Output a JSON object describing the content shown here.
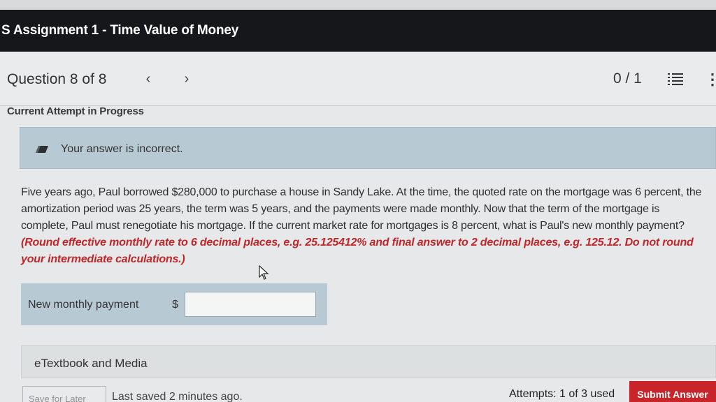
{
  "header": {
    "title": "S Assignment 1 - Time Value of Money"
  },
  "question_nav": {
    "label": "Question 8 of 8",
    "prev_icon": "chevron-left-icon",
    "next_icon": "chevron-right-icon",
    "score": "0 / 1",
    "list_icon": "list-icon",
    "more_icon": "more-vertical-icon"
  },
  "attempt": {
    "header": "Current Attempt in Progress"
  },
  "feedback": {
    "icon": "pencil-icon",
    "message": "Your answer is incorrect."
  },
  "question": {
    "text": "Five years ago, Paul borrowed $280,000 to purchase a house in Sandy Lake. At the time, the quoted rate on the mortgage was 6 percent, the amortization period was 25 years, the term was 5 years, and the payments were made monthly. Now that the term of the mortgage is complete, Paul must renegotiate his mortgage. If the current market rate for mortgages is 8 percent, what is Paul's new monthly payment? ",
    "hint": "(Round effective monthly rate to 6 decimal places, e.g. 25.125412% and final answer to 2 decimal places, e.g. 125.12. Do not round your intermediate calculations.)"
  },
  "answer": {
    "label": "New monthly payment",
    "currency": "$",
    "value": ""
  },
  "etextbook": {
    "label": "eTextbook and Media"
  },
  "footer": {
    "save_label": "Save for Later",
    "last_saved": "Last saved 2 minutes ago.",
    "attempts": "Attempts: 1 of 3 used",
    "submit_label": "Submit Answer"
  },
  "colors": {
    "title_bar": "#15171a",
    "feedback_bg": "#b7c9d3",
    "hint_red": "#c0262a",
    "submit_red": "#c8252b"
  }
}
